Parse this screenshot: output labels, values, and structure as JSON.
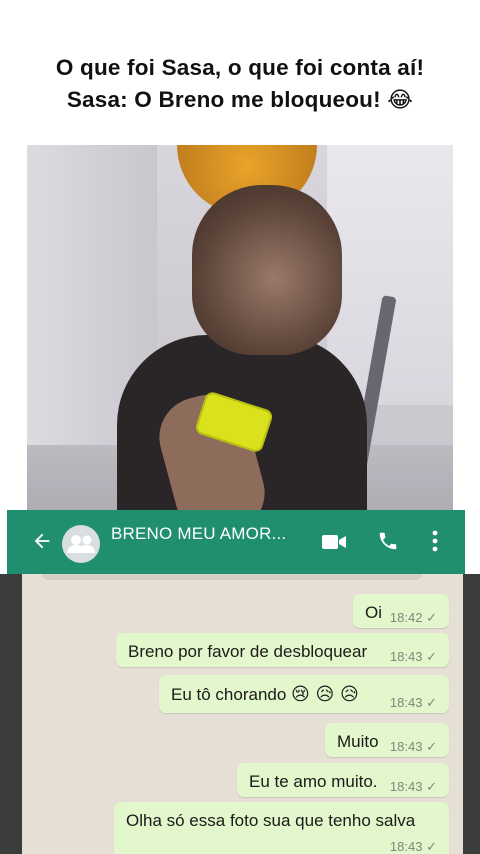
{
  "caption": {
    "line1": "O que foi Sasa, o que foi conta aí!",
    "line2": "Sasa: O Breno me bloqueou!",
    "line2_emoji": "😂"
  },
  "header": {
    "contact_name": "BRENO MEU AMOR...",
    "icons": [
      "back-arrow-icon",
      "group-avatar-icon",
      "video-call-icon",
      "phone-icon",
      "more-options-icon"
    ],
    "color": "#1f8f6f"
  },
  "messages": [
    {
      "text": "Oi",
      "emoji": "",
      "time": "18:42",
      "status": "✓"
    },
    {
      "text": "Breno por favor de desbloquear",
      "emoji": "",
      "time": "18:43",
      "status": "✓"
    },
    {
      "text": "Eu tô chorando ",
      "emoji": "😢 😥 😥",
      "time": "18:43",
      "status": "✓"
    },
    {
      "text": "Muito",
      "emoji": "",
      "time": "18:43",
      "status": "✓"
    },
    {
      "text": "Eu te amo muito.",
      "emoji": "",
      "time": "18:43",
      "status": "✓"
    },
    {
      "text": "Olha só essa foto sua que tenho salva",
      "emoji": "",
      "time": "18:43",
      "status": "✓"
    }
  ],
  "colors": {
    "bubble": "#e2f7cb",
    "chat_bg": "#e6dfd6",
    "header": "#1f8f6f"
  }
}
